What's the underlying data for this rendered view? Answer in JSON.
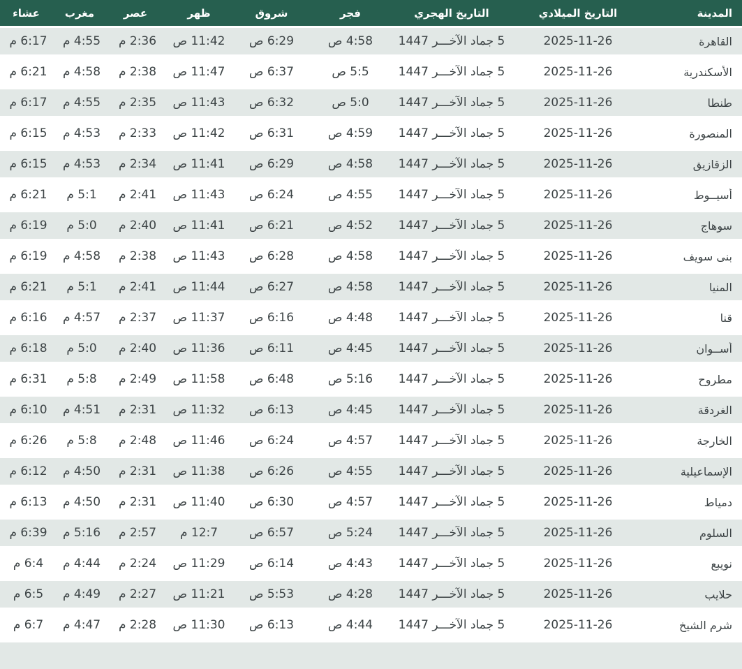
{
  "colors": {
    "header_bg": "#265f4f",
    "header_text": "#ffffff",
    "row_alt_bg": "#e2e8e6",
    "row_bg": "#ffffff",
    "text": "#3d4446"
  },
  "table": {
    "columns": [
      {
        "key": "city",
        "label": "المدينة"
      },
      {
        "key": "date_gregorian",
        "label": "التاريخ الميلادي"
      },
      {
        "key": "date_hijri",
        "label": "التاريخ الهجري"
      },
      {
        "key": "fajr",
        "label": "فجر"
      },
      {
        "key": "shorouq",
        "label": "شروق"
      },
      {
        "key": "dhuhr",
        "label": "ظهر"
      },
      {
        "key": "asr",
        "label": "عصر"
      },
      {
        "key": "maghrib",
        "label": "مغرب"
      },
      {
        "key": "isha",
        "label": "عشاء"
      }
    ],
    "rows": [
      {
        "city": "القاهرة",
        "date_gregorian": "2025-11-26",
        "date_hijri": "5 جماد الآخـــر 1447",
        "fajr": "4:58 ص",
        "shorouq": "6:29 ص",
        "dhuhr": "11:42 ص",
        "asr": "2:36 م",
        "maghrib": "4:55 م",
        "isha": "6:17 م"
      },
      {
        "city": "الأسكندرية",
        "date_gregorian": "2025-11-26",
        "date_hijri": "5 جماد الآخـــر 1447",
        "fajr": "5:5 ص",
        "shorouq": "6:37 ص",
        "dhuhr": "11:47 ص",
        "asr": "2:38 م",
        "maghrib": "4:58 م",
        "isha": "6:21 م"
      },
      {
        "city": "طنطا",
        "date_gregorian": "2025-11-26",
        "date_hijri": "5 جماد الآخـــر 1447",
        "fajr": "5:0 ص",
        "shorouq": "6:32 ص",
        "dhuhr": "11:43 ص",
        "asr": "2:35 م",
        "maghrib": "4:55 م",
        "isha": "6:17 م"
      },
      {
        "city": "المنصورة",
        "date_gregorian": "2025-11-26",
        "date_hijri": "5 جماد الآخـــر 1447",
        "fajr": "4:59 ص",
        "shorouq": "6:31 ص",
        "dhuhr": "11:42 ص",
        "asr": "2:33 م",
        "maghrib": "4:53 م",
        "isha": "6:15 م"
      },
      {
        "city": "الزقازيق",
        "date_gregorian": "2025-11-26",
        "date_hijri": "5 جماد الآخـــر 1447",
        "fajr": "4:58 ص",
        "shorouq": "6:29 ص",
        "dhuhr": "11:41 ص",
        "asr": "2:34 م",
        "maghrib": "4:53 م",
        "isha": "6:15 م"
      },
      {
        "city": "أسيــوط",
        "date_gregorian": "2025-11-26",
        "date_hijri": "5 جماد الآخـــر 1447",
        "fajr": "4:55 ص",
        "shorouq": "6:24 ص",
        "dhuhr": "11:43 ص",
        "asr": "2:41 م",
        "maghrib": "5:1 م",
        "isha": "6:21 م"
      },
      {
        "city": "سوهاج",
        "date_gregorian": "2025-11-26",
        "date_hijri": "5 جماد الآخـــر 1447",
        "fajr": "4:52 ص",
        "shorouq": "6:21 ص",
        "dhuhr": "11:41 ص",
        "asr": "2:40 م",
        "maghrib": "5:0 م",
        "isha": "6:19 م"
      },
      {
        "city": "بنى سويف",
        "date_gregorian": "2025-11-26",
        "date_hijri": "5 جماد الآخـــر 1447",
        "fajr": "4:58 ص",
        "shorouq": "6:28 ص",
        "dhuhr": "11:43 ص",
        "asr": "2:38 م",
        "maghrib": "4:58 م",
        "isha": "6:19 م"
      },
      {
        "city": "المنيا",
        "date_gregorian": "2025-11-26",
        "date_hijri": "5 جماد الآخـــر 1447",
        "fajr": "4:58 ص",
        "shorouq": "6:27 ص",
        "dhuhr": "11:44 ص",
        "asr": "2:41 م",
        "maghrib": "5:1 م",
        "isha": "6:21 م"
      },
      {
        "city": "قنا",
        "date_gregorian": "2025-11-26",
        "date_hijri": "5 جماد الآخـــر 1447",
        "fajr": "4:48 ص",
        "shorouq": "6:16 ص",
        "dhuhr": "11:37 ص",
        "asr": "2:37 م",
        "maghrib": "4:57 م",
        "isha": "6:16 م"
      },
      {
        "city": "أســوان",
        "date_gregorian": "2025-11-26",
        "date_hijri": "5 جماد الآخـــر 1447",
        "fajr": "4:45 ص",
        "shorouq": "6:11 ص",
        "dhuhr": "11:36 ص",
        "asr": "2:40 م",
        "maghrib": "5:0 م",
        "isha": "6:18 م"
      },
      {
        "city": "مطروح",
        "date_gregorian": "2025-11-26",
        "date_hijri": "5 جماد الآخـــر 1447",
        "fajr": "5:16 ص",
        "shorouq": "6:48 ص",
        "dhuhr": "11:58 ص",
        "asr": "2:49 م",
        "maghrib": "5:8 م",
        "isha": "6:31 م"
      },
      {
        "city": "الغردقة",
        "date_gregorian": "2025-11-26",
        "date_hijri": "5 جماد الآخـــر 1447",
        "fajr": "4:45 ص",
        "shorouq": "6:13 ص",
        "dhuhr": "11:32 ص",
        "asr": "2:31 م",
        "maghrib": "4:51 م",
        "isha": "6:10 م"
      },
      {
        "city": "الخارجة",
        "date_gregorian": "2025-11-26",
        "date_hijri": "5 جماد الآخـــر 1447",
        "fajr": "4:57 ص",
        "shorouq": "6:24 ص",
        "dhuhr": "11:46 ص",
        "asr": "2:48 م",
        "maghrib": "5:8 م",
        "isha": "6:26 م"
      },
      {
        "city": "الإسماعيلية",
        "date_gregorian": "2025-11-26",
        "date_hijri": "5 جماد الآخـــر 1447",
        "fajr": "4:55 ص",
        "shorouq": "6:26 ص",
        "dhuhr": "11:38 ص",
        "asr": "2:31 م",
        "maghrib": "4:50 م",
        "isha": "6:12 م"
      },
      {
        "city": "دمياط",
        "date_gregorian": "2025-11-26",
        "date_hijri": "5 جماد الآخـــر 1447",
        "fajr": "4:57 ص",
        "shorouq": "6:30 ص",
        "dhuhr": "11:40 ص",
        "asr": "2:31 م",
        "maghrib": "4:50 م",
        "isha": "6:13 م"
      },
      {
        "city": "السلوم",
        "date_gregorian": "2025-11-26",
        "date_hijri": "5 جماد الآخـــر 1447",
        "fajr": "5:24 ص",
        "shorouq": "6:57 ص",
        "dhuhr": "12:7 م",
        "asr": "2:57 م",
        "maghrib": "5:16 م",
        "isha": "6:39 م"
      },
      {
        "city": "نويبع",
        "date_gregorian": "2025-11-26",
        "date_hijri": "5 جماد الآخـــر 1447",
        "fajr": "4:43 ص",
        "shorouq": "6:14 ص",
        "dhuhr": "11:29 ص",
        "asr": "2:24 م",
        "maghrib": "4:44 م",
        "isha": "6:4 م"
      },
      {
        "city": "حلايب",
        "date_gregorian": "2025-11-26",
        "date_hijri": "5 جماد الآخـــر 1447",
        "fajr": "4:28 ص",
        "shorouq": "5:53 ص",
        "dhuhr": "11:21 ص",
        "asr": "2:27 م",
        "maghrib": "4:49 م",
        "isha": "6:5 م"
      },
      {
        "city": "شرم الشيخ",
        "date_gregorian": "2025-11-26",
        "date_hijri": "5 جماد الآخـــر 1447",
        "fajr": "4:44 ص",
        "shorouq": "6:13 ص",
        "dhuhr": "11:30 ص",
        "asr": "2:28 م",
        "maghrib": "4:47 م",
        "isha": "6:7 م"
      }
    ]
  }
}
